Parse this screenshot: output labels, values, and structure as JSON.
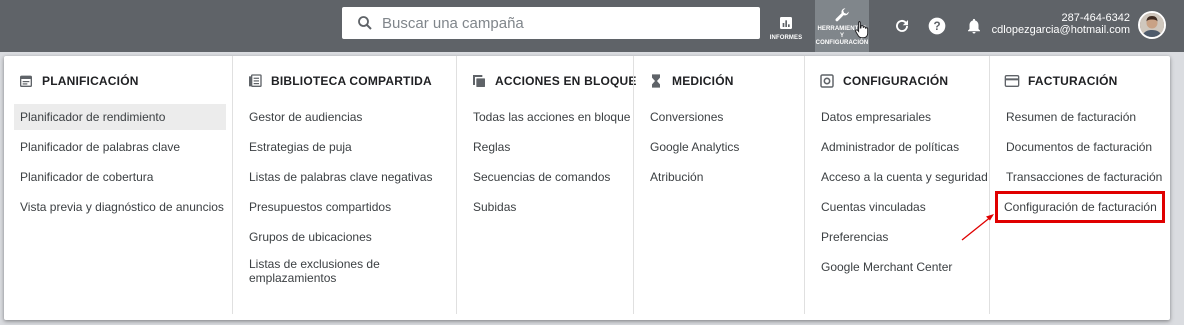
{
  "header": {
    "search": {
      "placeholder": "Buscar una campaña",
      "value": ""
    },
    "informes_label": "INFORMES",
    "herramientas_label_1": "HERRAMIENTAS",
    "herramientas_label_2": "Y",
    "herramientas_label_3": "CONFIGURACIÓN",
    "account": {
      "phone": "287-464-6342",
      "email": "cdlopezgarcia@hotmail.com"
    },
    "icons": [
      "search-icon",
      "reports-icon",
      "wrench-icon",
      "reload-icon",
      "help-icon",
      "bell-icon",
      "avatar"
    ]
  },
  "menu": {
    "columns": [
      {
        "title": "PLANIFICACIÓN",
        "icon": "calendar-icon",
        "items": [
          "Planificador de rendimiento",
          "Planificador de palabras clave",
          "Planificador de cobertura",
          "Vista previa y diagnóstico de anuncios"
        ]
      },
      {
        "title": "BIBLIOTECA COMPARTIDA",
        "icon": "library-icon",
        "items": [
          "Gestor de audiencias",
          "Estrategias de puja",
          "Listas de palabras clave negativas",
          "Presupuestos compartidos",
          "Grupos de ubicaciones",
          "Listas de exclusiones de emplazamientos"
        ]
      },
      {
        "title": "ACCIONES EN BLOQUE",
        "icon": "copy-icon",
        "items": [
          "Todas las acciones en bloque",
          "Reglas",
          "Secuencias de comandos",
          "Subidas"
        ]
      },
      {
        "title": "MEDICIÓN",
        "icon": "hourglass-icon",
        "items": [
          "Conversiones",
          "Google Analytics",
          "Atribución"
        ]
      },
      {
        "title": "CONFIGURACIÓN",
        "icon": "settings-box-icon",
        "items": [
          "Datos empresariales",
          "Administrador de políticas",
          "Acceso a la cuenta y seguridad",
          "Cuentas vinculadas",
          "Preferencias",
          "Google Merchant Center"
        ]
      },
      {
        "title": "FACTURACIÓN",
        "icon": "credit-card-icon",
        "items": [
          "Resumen de facturación",
          "Documentos de facturación",
          "Transacciones de facturación",
          "Configuración de facturación"
        ]
      }
    ]
  },
  "colors": {
    "topbar": "#5f6368",
    "highlight": "#e00000",
    "active_bg": "#ececec"
  }
}
